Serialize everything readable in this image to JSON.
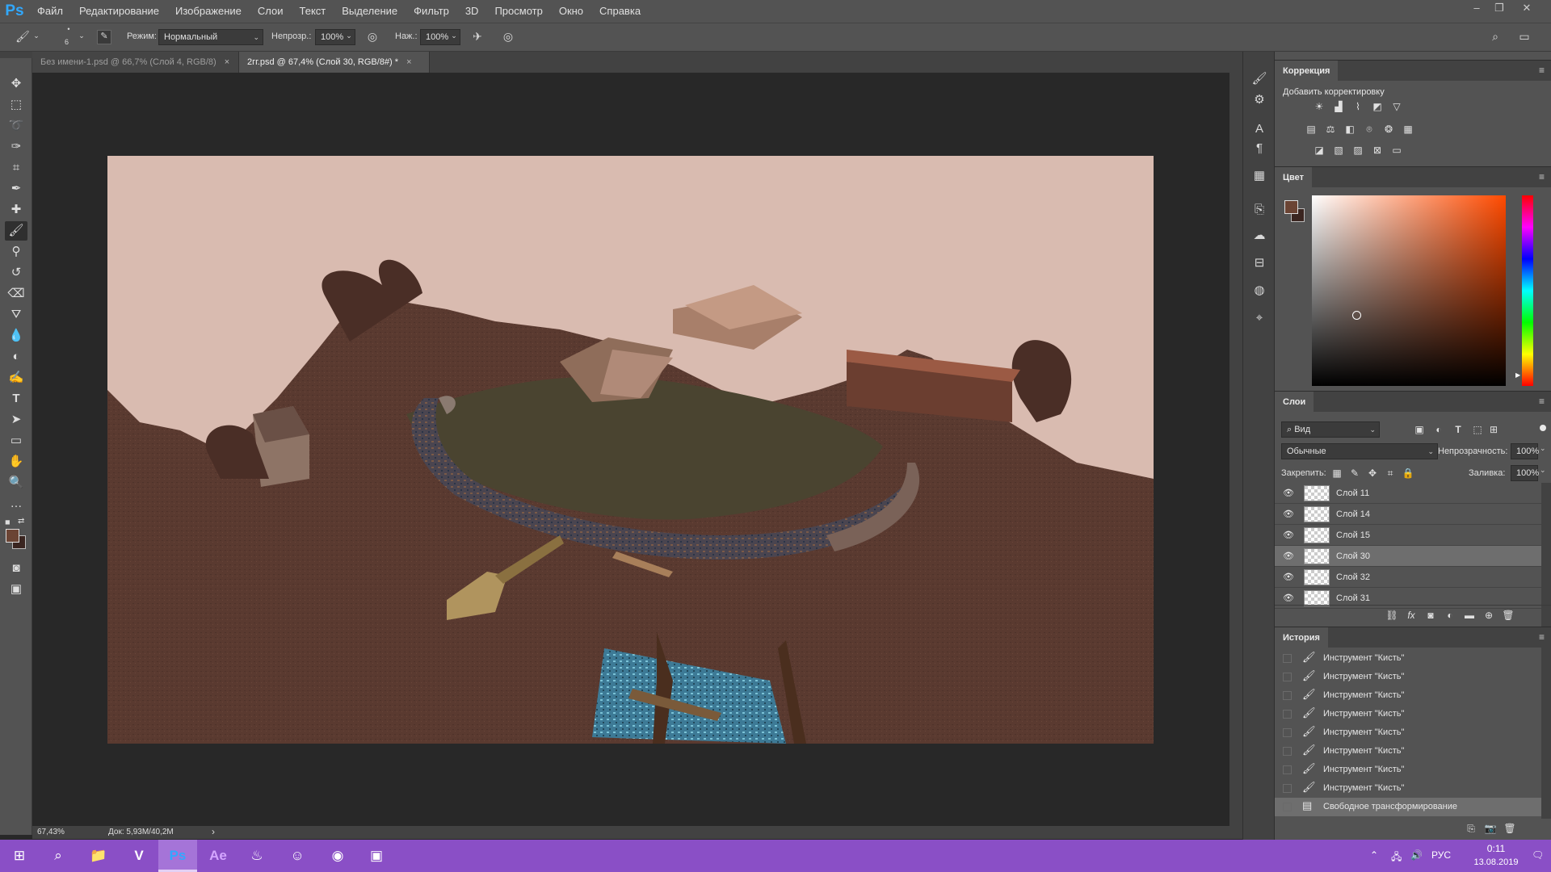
{
  "app": {
    "logo": "Ps"
  },
  "menu": [
    "Файл",
    "Редактирование",
    "Изображение",
    "Слои",
    "Текст",
    "Выделение",
    "Фильтр",
    "3D",
    "Просмотр",
    "Окно",
    "Справка"
  ],
  "options": {
    "brush_size": "6",
    "mode_label": "Режим:",
    "mode_value": "Нормальный",
    "opacity_label": "Непрозр.:",
    "opacity_value": "100%",
    "flow_label": "Наж.:",
    "flow_value": "100%"
  },
  "tabs": [
    {
      "label": "Без имени-1.psd @ 66,7% (Слой 4, RGB/8)",
      "close": "×"
    },
    {
      "label": "2гг.psd @ 67,4% (Слой 30, RGB/8#) *",
      "close": "×"
    }
  ],
  "status": {
    "zoom": "67,43%",
    "doc": "Док: 5,93M/40,2M",
    "arrow": "›"
  },
  "panels": {
    "adjustments": {
      "title": "Коррекция",
      "subtitle": "Добавить корректировку"
    },
    "color": {
      "title": "Цвет",
      "fg": "#6b4434",
      "bg": "#3a2520"
    },
    "layers": {
      "title": "Слои",
      "search_label": "Вид",
      "blend": "Обычные",
      "opacity_label": "Непрозрачность:",
      "opacity_value": "100%",
      "lock_label": "Закрепить:",
      "fill_label": "Заливка:",
      "fill_value": "100%",
      "items": [
        {
          "name": "Слой 11"
        },
        {
          "name": "Слой 14"
        },
        {
          "name": "Слой 15"
        },
        {
          "name": "Слой 30"
        },
        {
          "name": "Слой 32"
        },
        {
          "name": "Слой 31"
        }
      ]
    },
    "history": {
      "title": "История",
      "items": [
        {
          "name": "Инструмент \"Кисть\""
        },
        {
          "name": "Инструмент \"Кисть\""
        },
        {
          "name": "Инструмент \"Кисть\""
        },
        {
          "name": "Инструмент \"Кисть\""
        },
        {
          "name": "Инструмент \"Кисть\""
        },
        {
          "name": "Инструмент \"Кисть\""
        },
        {
          "name": "Инструмент \"Кисть\""
        },
        {
          "name": "Инструмент \"Кисть\""
        },
        {
          "name": "Свободное трансформирование"
        }
      ]
    }
  },
  "taskbar": {
    "lang": "РУС",
    "time": "0:11",
    "date": "13.08.2019",
    "accent": "#8a4fc6"
  }
}
